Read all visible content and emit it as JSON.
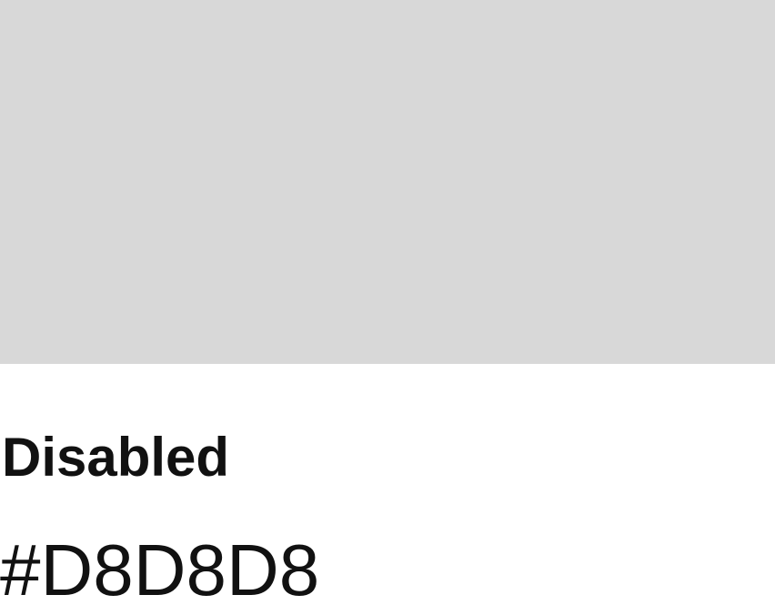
{
  "swatch": {
    "name": "Disabled",
    "hex_label": "#D8D8D8",
    "color": "#D8D8D8"
  },
  "colors": {
    "text": "#111111",
    "background": "#FFFFFF"
  }
}
